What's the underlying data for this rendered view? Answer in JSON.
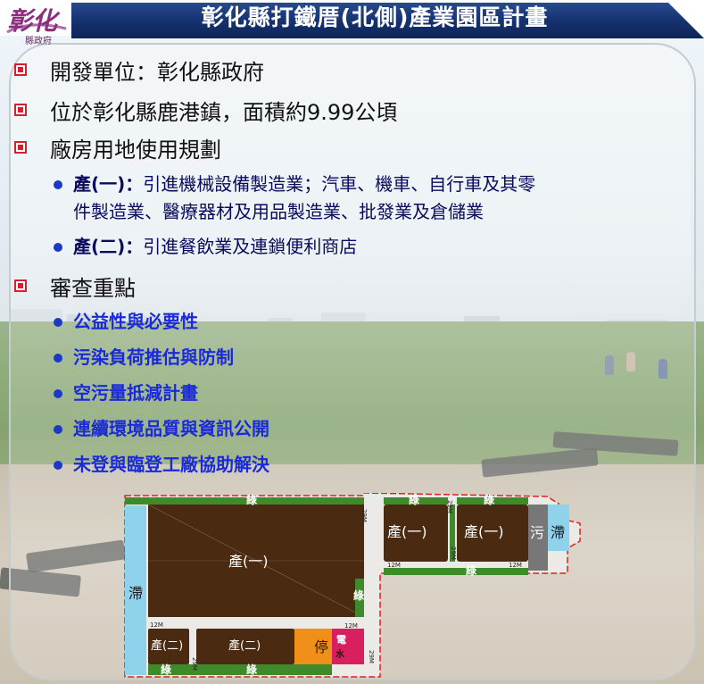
{
  "header": {
    "title": "彰化縣打鐵厝(北側)產業園區計畫",
    "logo_main": "彰化",
    "logo_sub": "縣政府"
  },
  "bullets": [
    {
      "text": "開發單位：彰化縣政府"
    },
    {
      "text": "位於彰化縣鹿港鎮，面積約9.99公頃"
    },
    {
      "text": "廠房用地使用規劃"
    },
    {
      "text": "審查重點"
    }
  ],
  "zones": [
    {
      "label": "產(一)：",
      "line1": "引進機械設備製造業；汽車、機車、自行車及其零",
      "line2": "件製造業、醫療器材及用品製造業、批發業及倉儲業"
    },
    {
      "label": "產(二)：",
      "line1": "引進餐飲業及連鎖便利商店"
    }
  ],
  "review_points": [
    "公益性與必要性",
    "污染負荷推估與防制",
    "空污量抵減計畫",
    "連續環境品質與資訊公開",
    "未登與臨登工廠協助解決"
  ],
  "map": {
    "industry1": "產(一)",
    "industry2": "產(二)",
    "green": "綠",
    "detention": "滯",
    "sewage": "污",
    "parking": "停",
    "water": "水",
    "water_top": "電",
    "dims": {
      "a": "12M",
      "b": "12M",
      "c": "12M",
      "d": "12M",
      "e": "29M",
      "f": "29M",
      "g": "29M",
      "h": "29M",
      "i": "29M"
    }
  },
  "colors": {
    "header": "#14306e",
    "bullet_marker": "#d8202c",
    "sub_bullet": "#1c38c7",
    "industry": "#4a2a10",
    "green_strip": "#3f8a2a",
    "detention": "#8fd2ec",
    "sewage": "#777777",
    "parking": "#f0901a"
  }
}
